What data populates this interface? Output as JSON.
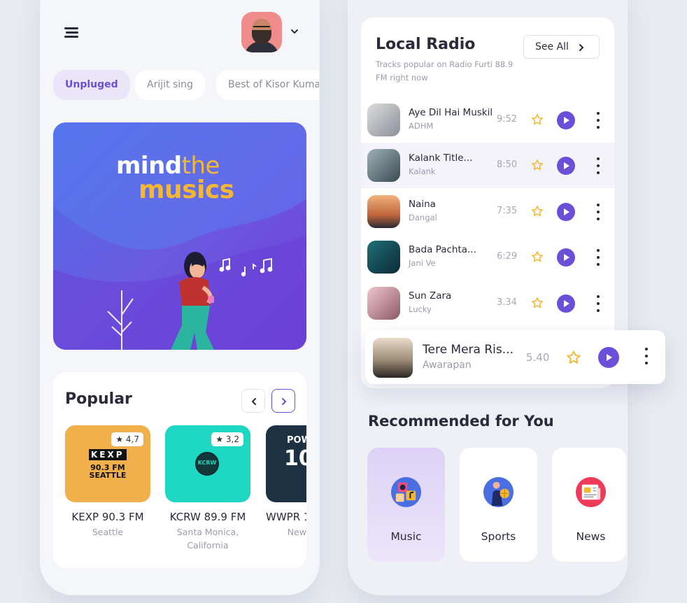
{
  "left": {
    "chips": [
      "Unpluged",
      "Arijit sing",
      "Best of Kisor Kuma"
    ],
    "hero": {
      "word_mind": "mind",
      "word_the": "the",
      "word_musics": "musics"
    },
    "popular": {
      "title": "Popular",
      "stations": [
        {
          "name": "KEXP 90.3 FM",
          "city": "Seattle",
          "rating": "★ 4,7",
          "logo_text_1": "KEXP",
          "logo_text_2": "90.3 FM",
          "logo_text_3": "SEATTLE",
          "color": "#f2b04d"
        },
        {
          "name": "KCRW 89.9 FM",
          "city": "Santa Monica, California",
          "rating": "★ 3,2",
          "logo_text_1": "KCRW",
          "color": "#1ed7c2"
        },
        {
          "name": "WWPR 1",
          "city": "New",
          "logo_text_1": "POW",
          "logo_text_2": "10",
          "color": "#1d3142"
        }
      ]
    }
  },
  "right": {
    "local_radio": {
      "title": "Local Radio",
      "subtitle": "Tracks popular on Radio Furti 88.9 FM right now",
      "see_all": "See All",
      "tracks": [
        {
          "title": "Aye Dil Hai Muskil",
          "artist": "ADHM",
          "time": "9:52"
        },
        {
          "title": "Kalank Title...",
          "artist": "Kalank",
          "time": "8:50"
        },
        {
          "title": "Naina",
          "artist": "Dangal",
          "time": "7:35"
        },
        {
          "title": "Bada Pachta...",
          "artist": "Jani Ve",
          "time": "6:29"
        },
        {
          "title": "Sun Zara",
          "artist": "Lucky",
          "time": "3.34"
        }
      ]
    },
    "now_playing": {
      "title": "Tere Mera Ris...",
      "artist": "Awarapan",
      "time": "5.40"
    },
    "recommended": {
      "title": "Recommended for You",
      "categories": [
        "Music",
        "Sports",
        "News"
      ]
    }
  },
  "colors": {
    "accent": "#6b4fd8",
    "star": "#f4b731",
    "hero_yellow": "#f7b733"
  }
}
